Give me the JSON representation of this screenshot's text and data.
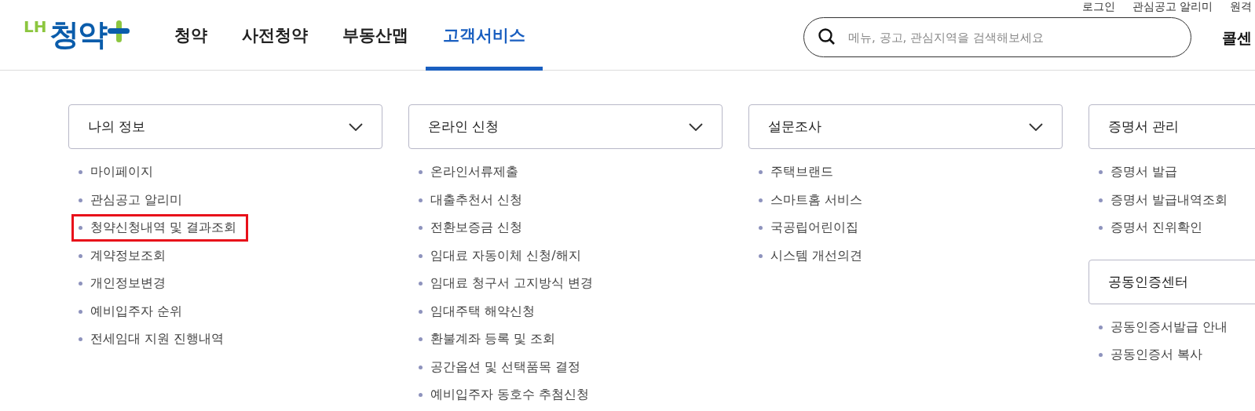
{
  "header": {
    "logo": {
      "prefix": "LH",
      "name": "청약"
    },
    "nav": [
      {
        "label": "청약",
        "selected": false
      },
      {
        "label": "사전청약",
        "selected": false
      },
      {
        "label": "부동산맵",
        "selected": false
      },
      {
        "label": "고객서비스",
        "selected": true
      }
    ],
    "util_links": [
      "로그인",
      "관심공고 알리미",
      "원격"
    ],
    "search": {
      "placeholder": "메뉴, 공고, 관심지역을 검색해보세요"
    },
    "call_center": "콜센"
  },
  "columns": [
    {
      "groups": [
        {
          "title": "나의 정보",
          "chevron": true,
          "items": [
            {
              "label": "마이페이지",
              "highlighted": false
            },
            {
              "label": "관심공고 알리미",
              "highlighted": false
            },
            {
              "label": "청약신청내역 및 결과조회",
              "highlighted": true
            },
            {
              "label": "계약정보조회",
              "highlighted": false
            },
            {
              "label": "개인정보변경",
              "highlighted": false
            },
            {
              "label": "예비입주자 순위",
              "highlighted": false
            },
            {
              "label": "전세임대 지원 진행내역",
              "highlighted": false
            }
          ]
        }
      ]
    },
    {
      "groups": [
        {
          "title": "온라인 신청",
          "chevron": true,
          "items": [
            {
              "label": "온라인서류제출",
              "highlighted": false
            },
            {
              "label": "대출추천서 신청",
              "highlighted": false
            },
            {
              "label": "전환보증금 신청",
              "highlighted": false
            },
            {
              "label": "임대료 자동이체 신청/해지",
              "highlighted": false
            },
            {
              "label": "임대료 청구서 고지방식 변경",
              "highlighted": false
            },
            {
              "label": "임대주택 해약신청",
              "highlighted": false
            },
            {
              "label": "환불계좌 등록 및 조회",
              "highlighted": false
            },
            {
              "label": "공간옵션 및 선택품목 결정",
              "highlighted": false
            },
            {
              "label": "예비입주자 동호수 추첨신청",
              "highlighted": false
            }
          ]
        }
      ]
    },
    {
      "groups": [
        {
          "title": "설문조사",
          "chevron": true,
          "items": [
            {
              "label": "주택브랜드",
              "highlighted": false
            },
            {
              "label": "스마트홈 서비스",
              "highlighted": false
            },
            {
              "label": "국공립어린이집",
              "highlighted": false
            },
            {
              "label": "시스템 개선의견",
              "highlighted": false
            }
          ]
        }
      ]
    },
    {
      "groups": [
        {
          "title": "증명서 관리",
          "items": [
            {
              "label": "증명서 발급",
              "highlighted": false
            },
            {
              "label": "증명서 발급내역조회",
              "highlighted": false
            },
            {
              "label": "증명서 진위확인",
              "highlighted": false
            }
          ]
        },
        {
          "title": "공동인증센터",
          "items": [
            {
              "label": "공동인증서발급 안내",
              "highlighted": false
            },
            {
              "label": "공동인증서 복사",
              "highlighted": false
            }
          ]
        }
      ]
    }
  ]
}
